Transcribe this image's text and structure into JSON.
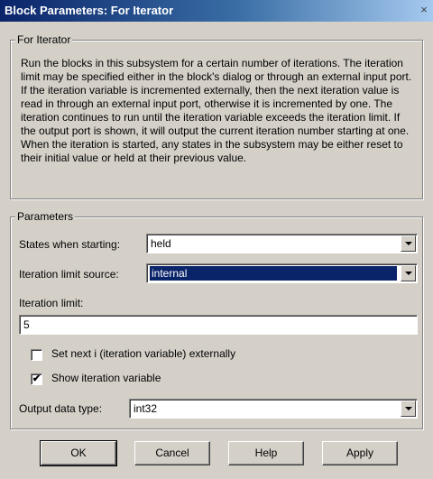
{
  "window": {
    "title": "Block Parameters: For Iterator",
    "close_glyph": "×"
  },
  "description_group": {
    "label": "For Iterator",
    "text": "Run the blocks in this subsystem for a certain number of iterations.  The iteration limit may be specified either in the block's dialog or through an external input port.  If the iteration variable is incremented externally, then the next iteration value is read in through an external input port, otherwise it is incremented by one.  The iteration continues to run until the iteration variable exceeds the iteration limit.  If the output port is shown, it will output the current iteration number starting at one.  When the iteration is started, any states in the subsystem may be either reset to their initial value or held at their previous value."
  },
  "parameters_group": {
    "label": "Parameters",
    "states_label": "States when starting:",
    "states_value": "held",
    "limit_source_label": "Iteration limit source:",
    "limit_source_value": "internal",
    "limit_label": "Iteration limit:",
    "limit_value": "5",
    "set_next_label": "Set next i (iteration variable) externally",
    "set_next_checked": false,
    "show_var_label": "Show iteration variable",
    "show_var_checked": true,
    "check_glyph": "✔",
    "output_type_label": "Output data type:",
    "output_type_value": "int32"
  },
  "buttons": {
    "ok": "OK",
    "cancel": "Cancel",
    "help": "Help",
    "apply": "Apply"
  }
}
